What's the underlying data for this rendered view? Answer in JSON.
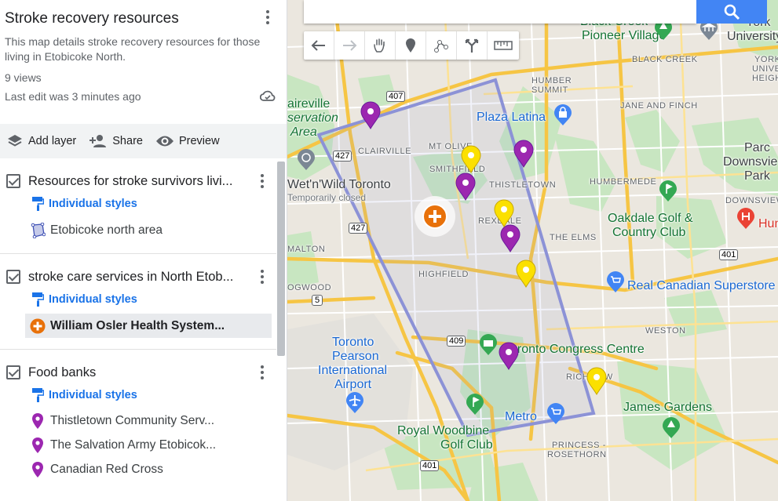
{
  "panel": {
    "title": "Stroke recovery resources",
    "description": "This map details stroke recovery resources for those living in Etobicoke North.",
    "views": "9 views",
    "last_edit": "Last edit was 3 minutes ago",
    "toolbar": {
      "add_layer": "Add layer",
      "share": "Share",
      "preview": "Preview"
    },
    "layers": [
      {
        "name": "Resources for stroke survivors livi...",
        "styles": "Individual styles",
        "items": [
          {
            "label": "Etobicoke north area",
            "icon": "polygon-icon"
          }
        ]
      },
      {
        "name": "stroke care services in North Etob...",
        "styles": "Individual styles",
        "items": [
          {
            "label": "William Osler Health System...",
            "icon": "hospital-cross-icon",
            "color": "#e8710a"
          }
        ]
      },
      {
        "name": "Food banks",
        "styles": "Individual styles",
        "items": [
          {
            "label": "Thistletown Community Serv...",
            "icon": "place-pin-icon",
            "color": "#9c27b0"
          },
          {
            "label": "The Salvation Army Etobicok...",
            "icon": "place-pin-icon",
            "color": "#9c27b0"
          },
          {
            "label": "Canadian Red Cross",
            "icon": "place-pin-icon",
            "color": "#9c27b0"
          }
        ]
      }
    ]
  },
  "map": {
    "labels": {
      "black_creek_pioneer": "Black Creek",
      "pioneer_village": "Pioneer Village",
      "york_university": "York",
      "university": "University",
      "black_creek": "BLACK CREEK",
      "humber_summit_1": "HUMBER",
      "humber_summit_2": "SUMMIT",
      "jane_finch": "JANE AND FINCH",
      "york_uni_heights_1": "YORK",
      "york_uni_heights_2": "UNIVE",
      "york_uni_heights_3": "HEIGH",
      "claireville_1": "aireville",
      "claireville_2": "servation",
      "claireville_3": "Area",
      "clairville": "CLAIRVILLE",
      "plaza_latina": "Plaza Latina",
      "mt_olive": "MT OLIVE",
      "smithfield": "SMITHFIELD",
      "thistletown": "THISTLETOWN",
      "humbermede": "HUMBERMEDE",
      "parc_1": "Parc",
      "parc_2": "Downsvie",
      "parc_3": "Park",
      "wetnwild": "Wet'n'Wild Toronto",
      "wetnwild_closed": "Temporarily closed",
      "downsview": "DOWNSVIEW",
      "oakdale_1": "Oakdale Golf &",
      "oakdale_2": "Country Club",
      "hum": "Hum",
      "rexdale": "REXDALE",
      "the_elms": "THE ELMS",
      "malton": "MALTON",
      "highfield": "HIGHFIELD",
      "real_canadian": "Real Canadian Superstore",
      "ogwood": "OGWOOD",
      "weston": "WESTON",
      "pearson_1": "Toronto",
      "pearson_2": "Pearson",
      "pearson_3": "International",
      "pearson_4": "Airport",
      "congress": "Toronto Congress Centre",
      "richview": "RICHVIEW",
      "james_gardens": "James Gardens",
      "metro": "Metro",
      "royal_woodbine_1": "Royal Woodbine",
      "royal_woodbine_2": "Golf Club",
      "princess_rosethorn_1": "PRINCESS -",
      "princess_rosethorn_2": "ROSETHORN",
      "hwy_407a": "407",
      "hwy_407b": "407",
      "hwy_427a": "427",
      "hwy_427b": "427",
      "hwy_409": "409",
      "hwy_401a": "401",
      "hwy_401b": "401",
      "hwy_5": "5",
      "hwy_27": "27"
    },
    "search_icon": "search-icon",
    "tools": [
      "undo-icon",
      "redo-icon",
      "hand-pan-icon",
      "add-marker-icon",
      "draw-line-icon",
      "directions-icon",
      "ruler-icon"
    ],
    "pin_colors": {
      "purple": "#9c27b0",
      "yellow": "#fbe000",
      "hospital": "#e8710a",
      "polygon": "#8c92d6"
    }
  }
}
